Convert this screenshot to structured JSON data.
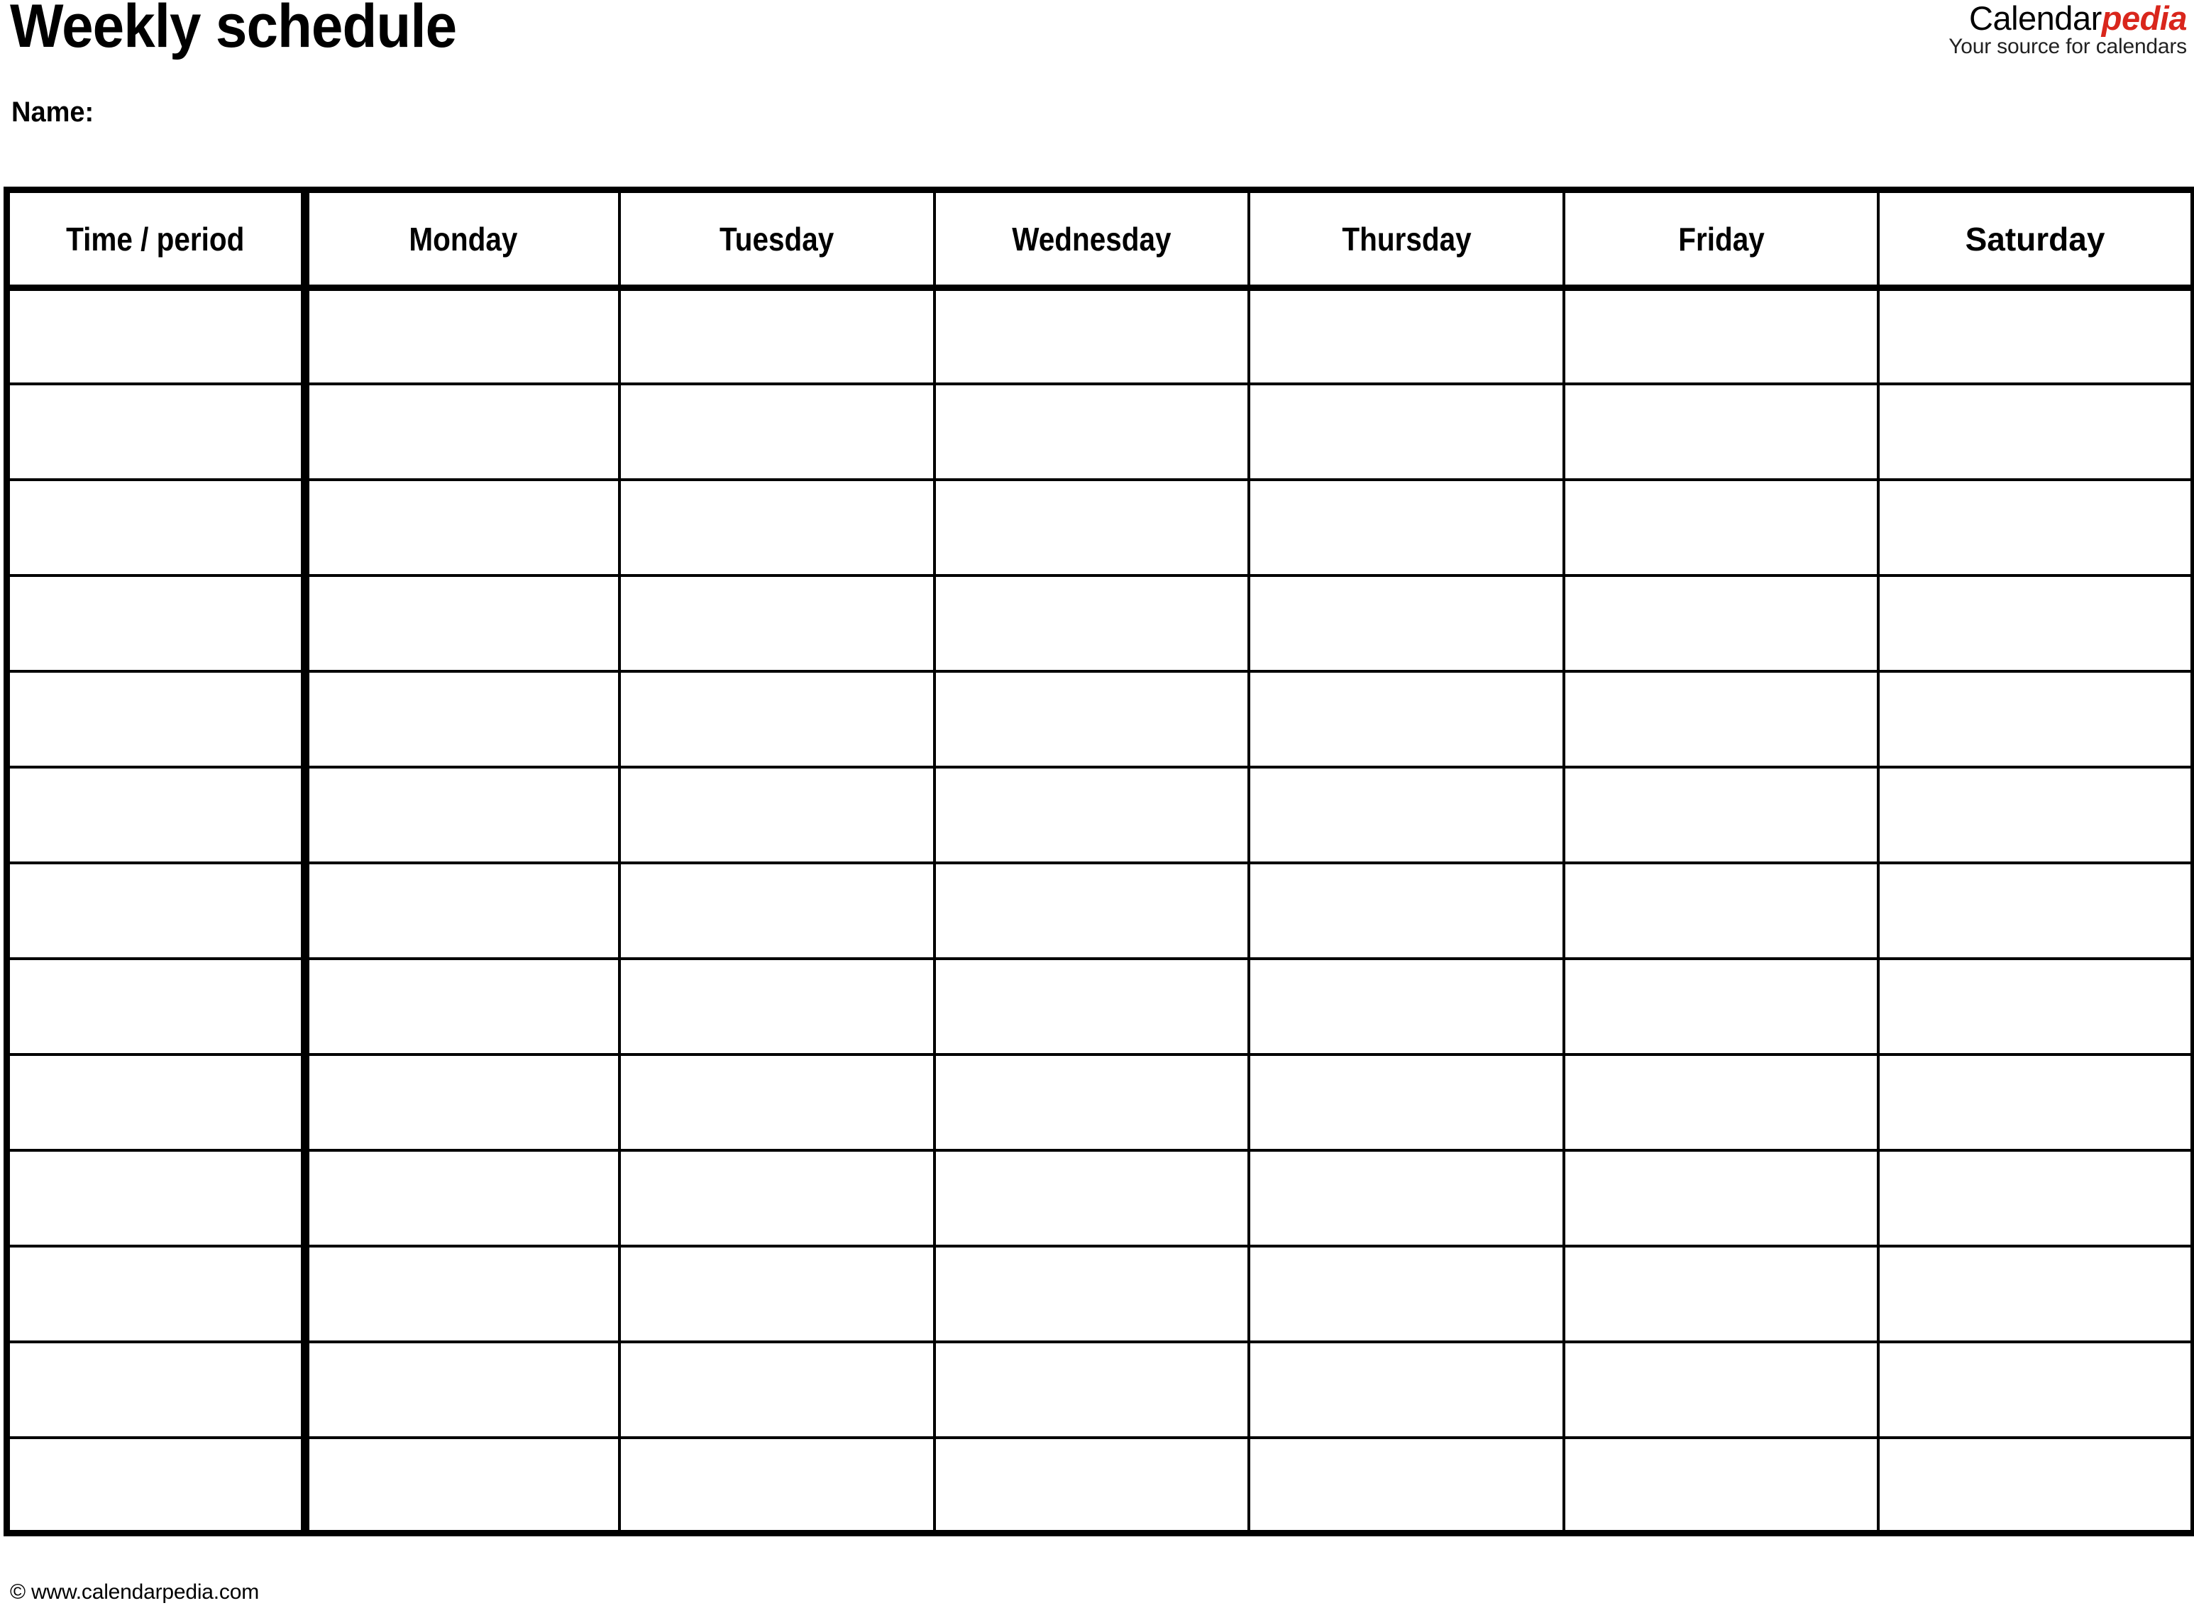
{
  "document": {
    "title": "Weekly schedule",
    "name_label": "Name:"
  },
  "brand": {
    "word_part1": "Calendar",
    "word_part2": "pedia",
    "tagline": "Your source for calendars",
    "accent_color": "#D9261C"
  },
  "table": {
    "columns": [
      {
        "key": "time",
        "label": "Time / period",
        "condensed": true
      },
      {
        "key": "monday",
        "label": "Monday",
        "condensed": true
      },
      {
        "key": "tuesday",
        "label": "Tuesday",
        "condensed": true
      },
      {
        "key": "wednesday",
        "label": "Wednesday",
        "condensed": true
      },
      {
        "key": "thursday",
        "label": "Thursday",
        "condensed": true
      },
      {
        "key": "friday",
        "label": "Friday",
        "condensed": true
      },
      {
        "key": "saturday",
        "label": "Saturday",
        "condensed": false
      }
    ],
    "row_count": 13,
    "rows": [
      {
        "time": "",
        "monday": "",
        "tuesday": "",
        "wednesday": "",
        "thursday": "",
        "friday": "",
        "saturday": ""
      },
      {
        "time": "",
        "monday": "",
        "tuesday": "",
        "wednesday": "",
        "thursday": "",
        "friday": "",
        "saturday": ""
      },
      {
        "time": "",
        "monday": "",
        "tuesday": "",
        "wednesday": "",
        "thursday": "",
        "friday": "",
        "saturday": ""
      },
      {
        "time": "",
        "monday": "",
        "tuesday": "",
        "wednesday": "",
        "thursday": "",
        "friday": "",
        "saturday": ""
      },
      {
        "time": "",
        "monday": "",
        "tuesday": "",
        "wednesday": "",
        "thursday": "",
        "friday": "",
        "saturday": ""
      },
      {
        "time": "",
        "monday": "",
        "tuesday": "",
        "wednesday": "",
        "thursday": "",
        "friday": "",
        "saturday": ""
      },
      {
        "time": "",
        "monday": "",
        "tuesday": "",
        "wednesday": "",
        "thursday": "",
        "friday": "",
        "saturday": ""
      },
      {
        "time": "",
        "monday": "",
        "tuesday": "",
        "wednesday": "",
        "thursday": "",
        "friday": "",
        "saturday": ""
      },
      {
        "time": "",
        "monday": "",
        "tuesday": "",
        "wednesday": "",
        "thursday": "",
        "friday": "",
        "saturday": ""
      },
      {
        "time": "",
        "monday": "",
        "tuesday": "",
        "wednesday": "",
        "thursday": "",
        "friday": "",
        "saturday": ""
      },
      {
        "time": "",
        "monday": "",
        "tuesday": "",
        "wednesday": "",
        "thursday": "",
        "friday": "",
        "saturday": ""
      },
      {
        "time": "",
        "monday": "",
        "tuesday": "",
        "wednesday": "",
        "thursday": "",
        "friday": "",
        "saturday": ""
      },
      {
        "time": "",
        "monday": "",
        "tuesday": "",
        "wednesday": "",
        "thursday": "",
        "friday": "",
        "saturday": ""
      }
    ]
  },
  "footer": {
    "copyright": "© www.calendarpedia.com"
  }
}
